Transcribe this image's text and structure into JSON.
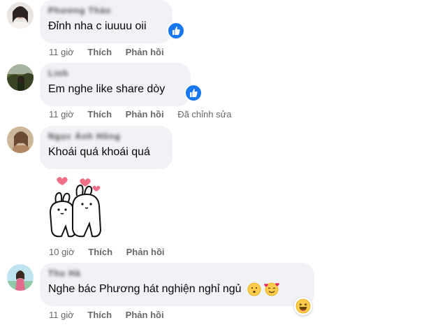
{
  "comments": [
    {
      "author": "Phương Thảo",
      "text": "Đỉnh nha c iuuuu oii",
      "time": "11 giờ",
      "like_label": "Thích",
      "reply_label": "Phản hồi",
      "edited": "",
      "reaction": "like-icon"
    },
    {
      "author": "Linh",
      "text": "Em nghe like share dòy",
      "time": "11 giờ",
      "like_label": "Thích",
      "reply_label": "Phản hồi",
      "edited": "Đã chỉnh sửa",
      "reaction": "like-icon"
    },
    {
      "author": "Ngọc Ánh Hồng",
      "text": "Khoái quá khoái quá",
      "time": "10 giờ",
      "like_label": "Thích",
      "reply_label": "Phản hồi",
      "edited": "",
      "sticker": "bunny-hearts-sticker"
    },
    {
      "author": "Thu Hà",
      "text": "Nghe bác Phương hát nghiện nghỉ ngủ",
      "time": "11 giờ",
      "like_label": "Thích",
      "reply_label": "Phản hồi",
      "edited": "",
      "reaction": "haha-icon"
    }
  ],
  "colors": {
    "bubble": "#f0f2f5",
    "like_blue": "#1877f2",
    "meta_gray": "#65676b"
  }
}
